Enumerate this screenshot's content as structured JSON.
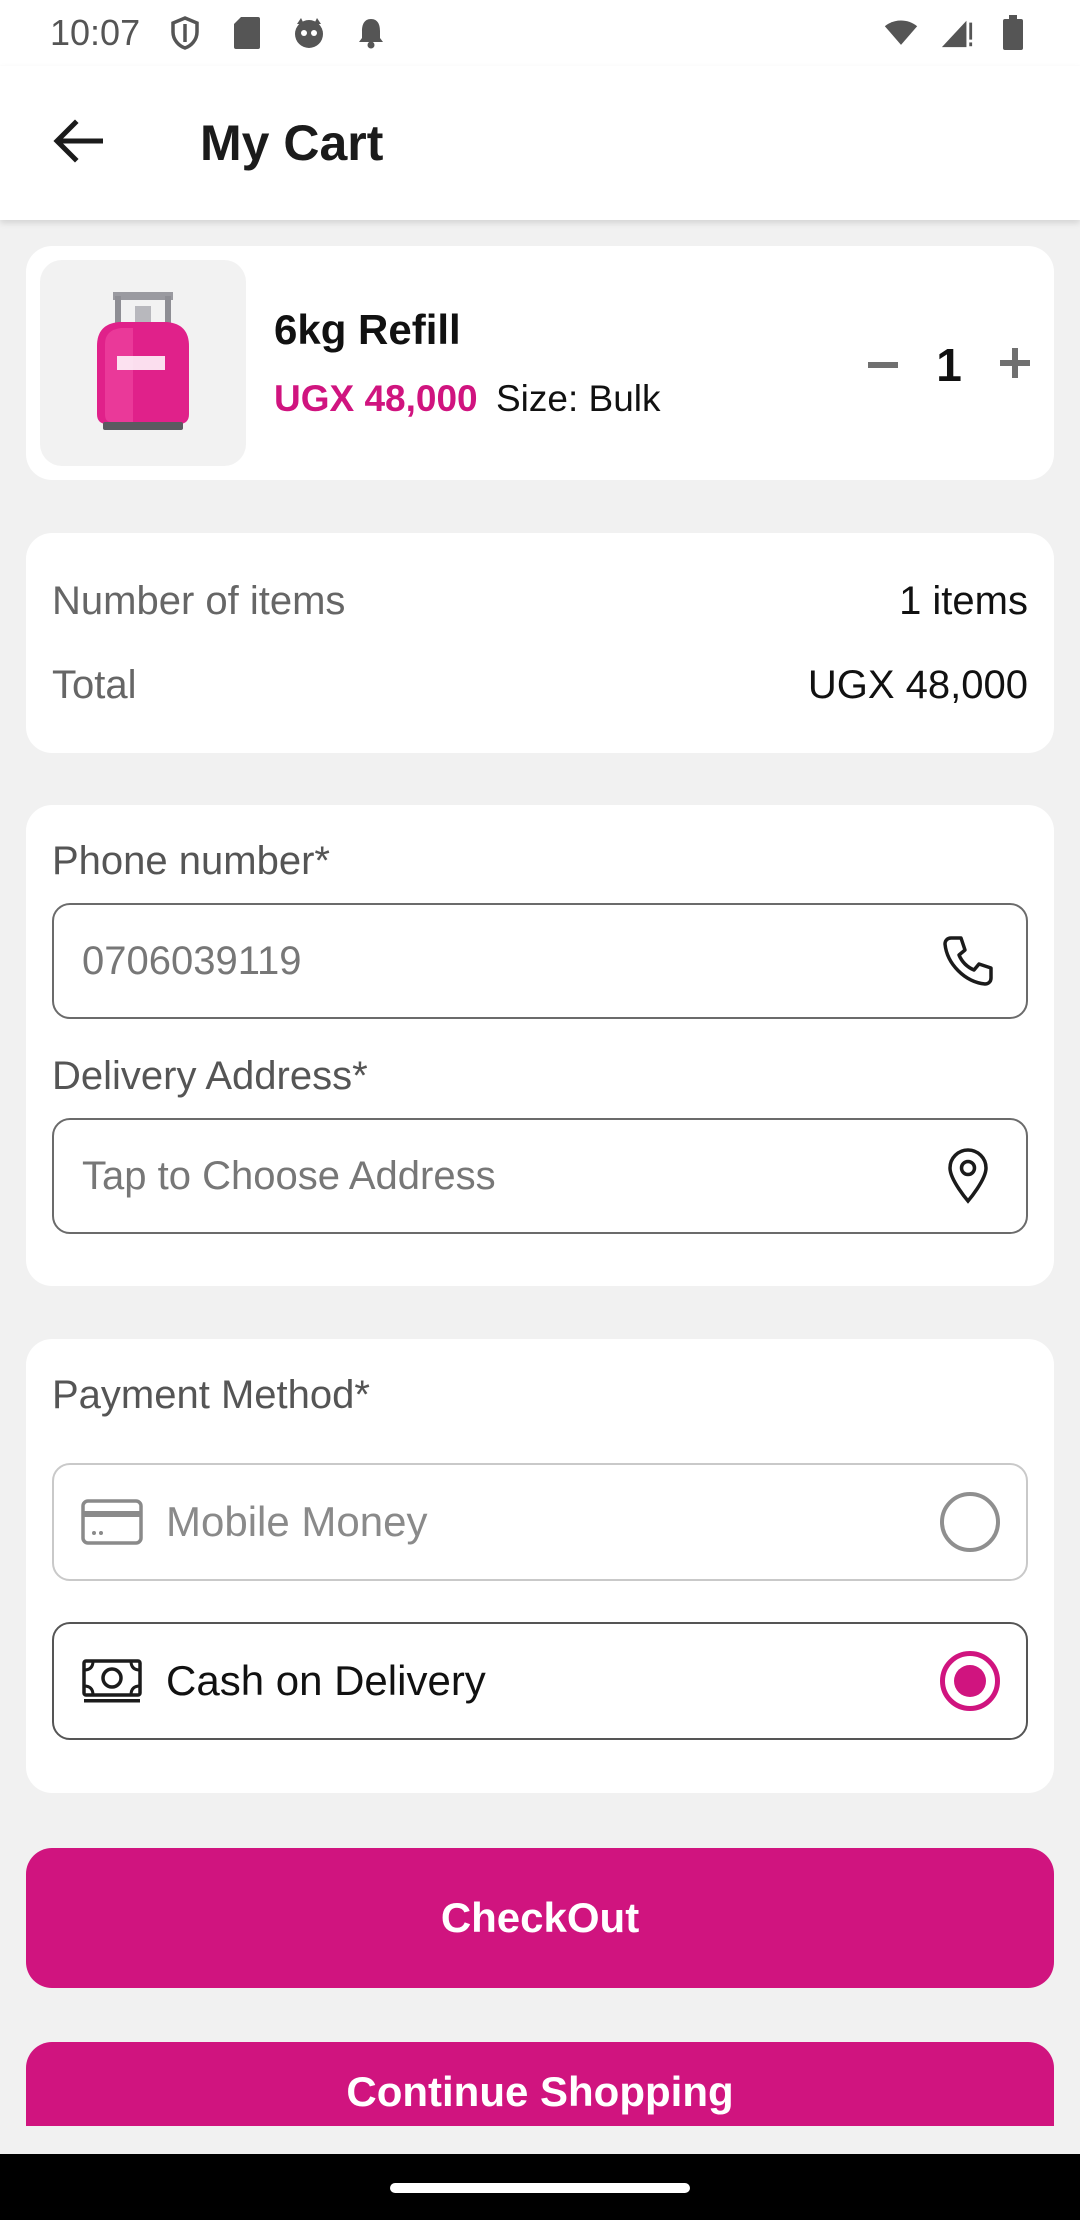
{
  "status_bar": {
    "time": "10:07",
    "icons_left": [
      "shield-icon",
      "sd-card-icon",
      "cat-face-icon",
      "bell-icon"
    ],
    "icons_right": [
      "wifi-icon",
      "signal-icon",
      "battery-icon"
    ]
  },
  "header": {
    "back_icon": "arrow-left-icon",
    "title": "My Cart"
  },
  "cart_item": {
    "name": "6kg Refill",
    "price": "UGX 48,000",
    "size": "Size: Bulk",
    "quantity": "1",
    "image_icon": "gas-cylinder-icon"
  },
  "summary": {
    "items_label": "Number of items",
    "items_value": "1 items",
    "total_label": "Total",
    "total_value": "UGX 48,000"
  },
  "form": {
    "phone_label": "Phone number*",
    "phone_placeholder": "0706039119",
    "phone_icon": "phone-icon",
    "address_label": "Delivery Address*",
    "address_placeholder": "Tap to Choose Address",
    "address_icon": "map-pin-icon"
  },
  "payment": {
    "label": "Payment Method*",
    "options": [
      {
        "label": "Mobile Money",
        "icon": "credit-card-icon",
        "selected": false
      },
      {
        "label": "Cash on Delivery",
        "icon": "cash-icon",
        "selected": true
      }
    ]
  },
  "buttons": {
    "checkout": "CheckOut",
    "continue": "Continue Shopping"
  },
  "colors": {
    "accent": "#d0147f",
    "background": "#f1f1f1",
    "card": "#ffffff"
  }
}
